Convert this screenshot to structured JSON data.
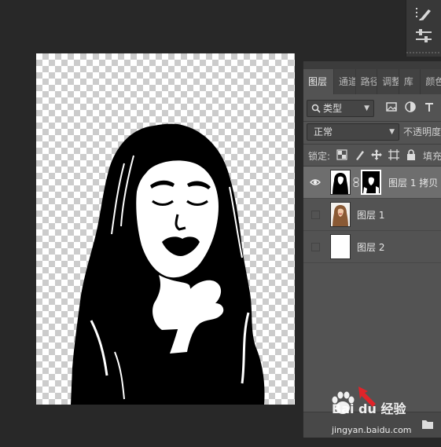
{
  "panel": {
    "tabs": [
      {
        "label": "图层",
        "active": true
      },
      {
        "label": "通道"
      },
      {
        "label": "路径"
      },
      {
        "label": "调整"
      },
      {
        "label": "库"
      },
      {
        "label": "颜色"
      }
    ],
    "filter": {
      "icon": "search-icon",
      "value": "类型"
    },
    "blend_mode": "正常",
    "opacity_label": "不透明度",
    "lock_label": "锁定:",
    "fill_label": "填充",
    "layers": [
      {
        "name": "图层 1 拷贝",
        "visible": true,
        "selected": true,
        "has_mask": true
      },
      {
        "name": "图层 1",
        "visible": false,
        "selected": false,
        "has_mask": false
      },
      {
        "name": "图层 2",
        "visible": false,
        "selected": false,
        "has_mask": false
      }
    ]
  },
  "watermark": {
    "brand": "Bai du 经验",
    "url": "jingyan.baidu.com"
  },
  "colors": {
    "app_bg": "#282828",
    "panel_bg": "#535353",
    "selected_layer": "#6e6e6e"
  }
}
